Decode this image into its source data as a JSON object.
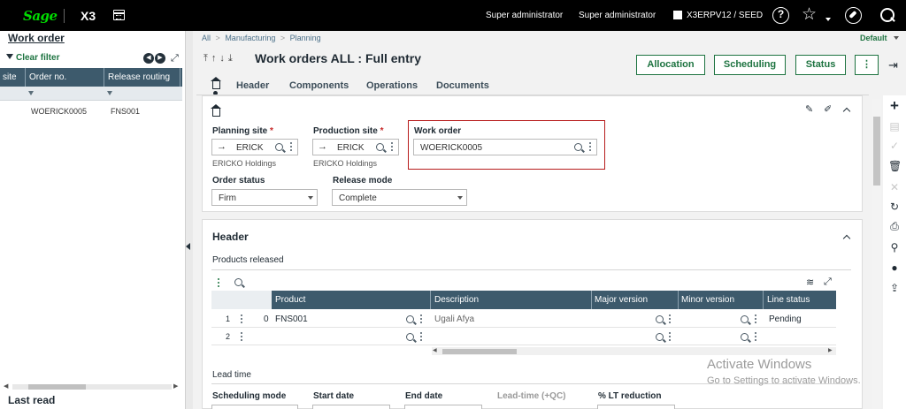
{
  "topbar": {
    "logo": "Sage",
    "app": "X3",
    "user_role": "Super administrator",
    "user_name": "Super administrator",
    "folder": "X3ERPV12 / SEED",
    "help_icon": "?"
  },
  "left_panel": {
    "title": "Work order",
    "clear_filter": "Clear filter",
    "columns": [
      "site",
      "Order no.",
      "Release routing"
    ],
    "rows": [
      {
        "order_no": "WOERICK0005",
        "release_routing": "FNS001"
      }
    ],
    "footer": "Last read"
  },
  "breadcrumb": [
    "All",
    ">",
    "Manufacturing",
    ">",
    "Planning"
  ],
  "view_selector": "Default",
  "page": {
    "title": "Work orders ALL : Full entry",
    "actions": [
      "Allocation",
      "Scheduling",
      "Status"
    ],
    "tabs": [
      "Header",
      "Components",
      "Operations",
      "Documents"
    ]
  },
  "form": {
    "planning_site": {
      "label": "Planning site",
      "value": "ERICK",
      "description": "ERICKO Holdings"
    },
    "production_site": {
      "label": "Production site",
      "value": "ERICK",
      "description": "ERICKO Holdings"
    },
    "work_order": {
      "label": "Work order",
      "value": "WOERICK0005"
    },
    "order_status": {
      "label": "Order status",
      "value": "Firm"
    },
    "release_mode": {
      "label": "Release mode",
      "value": "Complete"
    },
    "required_mark": "*"
  },
  "header_section": {
    "title": "Header",
    "products_released": "Products released",
    "grid_columns": [
      "Product",
      "Description",
      "Major version",
      "Minor version",
      "Line status"
    ],
    "grid_rows": [
      {
        "num": "1",
        "qty": "0",
        "product": "FNS001",
        "description": "Ugali Afya",
        "major": "",
        "minor": "",
        "status": "Pending"
      },
      {
        "num": "2",
        "qty": "",
        "product": "",
        "description": "",
        "major": "",
        "minor": "",
        "status": ""
      }
    ],
    "lead_time": "Lead time",
    "lead_columns": [
      "Scheduling mode",
      "Start date",
      "End date",
      "Lead-time (+QC)",
      "% LT reduction"
    ]
  },
  "watermark": {
    "line1": "Activate Windows",
    "line2": "Go to Settings to activate Windows."
  }
}
